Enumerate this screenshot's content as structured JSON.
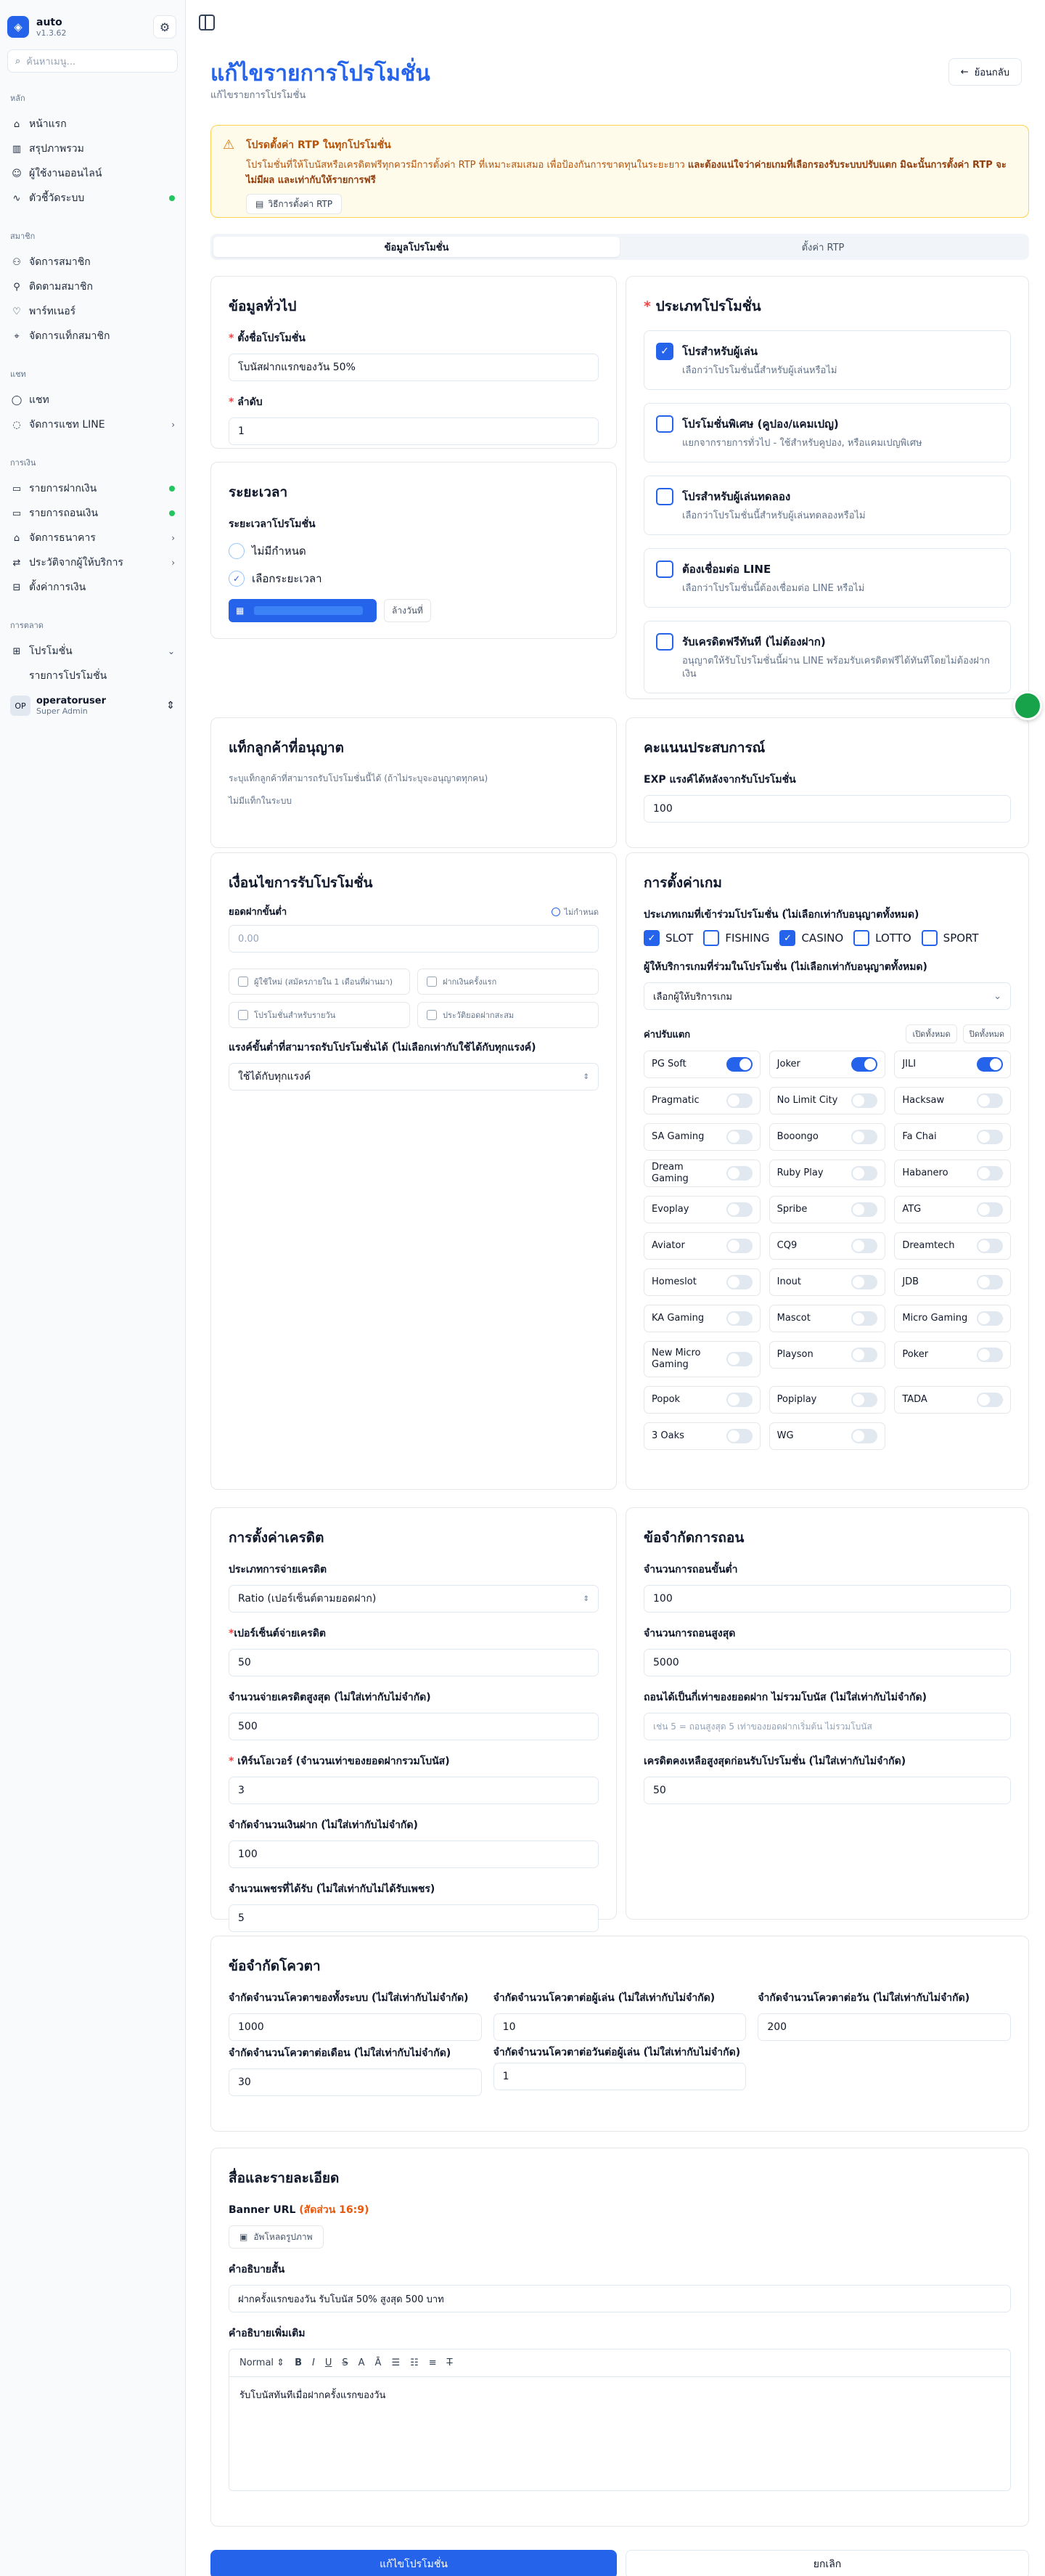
{
  "app": {
    "name": "auto",
    "version": "v1.3.62",
    "search_placeholder": "ค้นหาเมนู..."
  },
  "sidebar": {
    "sections": [
      {
        "title": "หลัก",
        "items": [
          {
            "label": "หน้าแรก",
            "icon": "home-icon"
          },
          {
            "label": "สรุปภาพรวม",
            "icon": "chart-icon"
          },
          {
            "label": "ผู้ใช้งานออนไลน์",
            "icon": "users-icon"
          },
          {
            "label": "ตัวชี้วัดระบบ",
            "icon": "activity-icon",
            "dot": true
          }
        ]
      },
      {
        "title": "สมาชิก",
        "items": [
          {
            "label": "จัดการสมาชิก",
            "icon": "user-cog-icon"
          },
          {
            "label": "ติดตามสมาชิก",
            "icon": "user-search-icon"
          },
          {
            "label": "พาร์ทเนอร์",
            "icon": "handshake-icon"
          },
          {
            "label": "จัดการแท็กสมาชิก",
            "icon": "tag-icon"
          }
        ]
      },
      {
        "title": "แชท",
        "items": [
          {
            "label": "แชท",
            "icon": "chat-icon"
          },
          {
            "label": "จัดการแชท LINE",
            "icon": "line-chat-icon",
            "chev": true
          }
        ]
      },
      {
        "title": "การเงิน",
        "items": [
          {
            "label": "รายการฝากเงิน",
            "icon": "deposit-icon",
            "dot": true
          },
          {
            "label": "รายการถอนเงิน",
            "icon": "withdraw-icon",
            "dot": true
          },
          {
            "label": "จัดการธนาคาร",
            "icon": "bank-icon",
            "chev": true
          },
          {
            "label": "ประวัติจากผู้ให้บริการ",
            "icon": "history-icon",
            "chev": true
          },
          {
            "label": "ตั้งค่าการเงิน",
            "icon": "money-settings-icon"
          }
        ]
      }
    ],
    "marketing": {
      "title": "การตลาด",
      "group": "โปรโมชั่น",
      "sub": "รายการโปรโมชั่น"
    },
    "user": {
      "initials": "OP",
      "name": "operatoruser",
      "role": "Super Admin"
    }
  },
  "page": {
    "title": "แก้ไขรายการโปรโมชั่น",
    "subtitle": "แก้ไขรายการโปรโมชั่น",
    "back": "ย้อนกลับ"
  },
  "alert": {
    "title": "โปรดตั้งค่า RTP ในทุกโปรโมชั่น",
    "body": "โปรโมชั่นที่ให้โบนัสหรือเครดิตฟรีทุกควรมีการตั้งค่า RTP ที่เหมาะสมเสมอ เพื่อป้องกันการขาดทุนในระยะยาว",
    "body_bold": "และต้องแน่ใจว่าค่ายเกมที่เลือกรองรับระบบปรับแตก มิฉะนั้นการตั้งค่า RTP จะไม่มีผล และเท่ากับให้รายการฟรี",
    "button": "วิธีการตั้งค่า RTP"
  },
  "tabs": [
    "ข้อมูลโปรโมชั่น",
    "ตั้งค่า RTP"
  ],
  "general": {
    "title": "ข้อมูลทั่วไป",
    "name_label": "ตั้งชื่อโปรโมชั่น",
    "name_value": "โบนัสฝากแรกของวัน 50%",
    "order_label": "ลำดับ",
    "order_value": "1"
  },
  "period": {
    "title": "ระยะเวลา",
    "label": "ระยะเวลาโปรโมชั่น",
    "opt1": "ไม่มีกำหนด",
    "opt2": "เลือกระยะเวลา",
    "clear": "ล้างวันที่"
  },
  "ptype": {
    "title": "ประเภทโปรโมชั่น",
    "items": [
      {
        "t": "โปรสำหรับผู้เล่น",
        "d": "เลือกว่าโปรโมชั่นนี้สำหรับผู้เล่นหรือไม่",
        "on": true
      },
      {
        "t": "โปรโมชั่นพิเศษ (คูปอง/แคมเปญ)",
        "d": "แยกจากรายการทั่วไป - ใช้สำหรับคูปอง, หรือแคมเปญพิเศษ",
        "on": false
      },
      {
        "t": "โปรสำหรับผู้เล่นทดลอง",
        "d": "เลือกว่าโปรโมชั่นนี้สำหรับผู้เล่นทดลองหรือไม่",
        "on": false
      },
      {
        "t": "ต้องเชื่อมต่อ LINE",
        "d": "เลือกว่าโปรโมชั่นนี้ต้องเชื่อมต่อ LINE หรือไม่",
        "on": false
      },
      {
        "t": "รับเครดิตฟรีทันที (ไม่ต้องฝาก)",
        "d": "อนุญาตให้รับโปรโมชั่นนี้ผ่าน LINE พร้อมรับเครดิตฟรีได้ทันทีโดยไม่ต้องฝากเงิน",
        "on": false
      }
    ]
  },
  "tags": {
    "title": "แท็กลูกค้าที่อนุญาต",
    "desc": "ระบุแท็กลูกค้าที่สามารถรับโปรโมชั่นนี้ได้ (ถ้าไม่ระบุจะอนุญาตทุกคน)",
    "empty": "ไม่มีแท็กในระบบ"
  },
  "exp": {
    "title": "คะแนนประสบการณ์",
    "label": "EXP แรงค์ได้หลังจากรับโปรโมชั่น",
    "value": "100"
  },
  "cond": {
    "title": "เงื่อนไขการรับโปรโมชั่น",
    "min_label": "ยอดฝากขั้นต่ำ",
    "no_limit": "ไม่กำหนด",
    "min_ph": "0.00",
    "checks": [
      "ผู้ใช้ใหม่ (สมัครภายใน 1 เดือนที่ผ่านมา)",
      "ฝากเงินครั้งแรก",
      "โปรโมชั่นสำหรับรายวัน",
      "ประวัติยอดฝากสะสม"
    ],
    "rank_label": "แรงค์ขั้นต่ำที่สามารถรับโปรโมชั่นได้ (ไม่เลือกเท่ากับใช้ได้กับทุกแรงค์)",
    "rank_value": "ใช้ได้กับทุกแรงค์"
  },
  "game": {
    "title": "การตั้งค่าเกม",
    "types_label": "ประเภทเกมที่เข้าร่วมโปรโมชั่น (ไม่เลือกเท่ากับอนุญาตทั้งหมด)",
    "types": [
      {
        "n": "SLOT",
        "on": true
      },
      {
        "n": "FISHING",
        "on": false
      },
      {
        "n": "CASINO",
        "on": true
      },
      {
        "n": "LOTTO",
        "on": false
      },
      {
        "n": "SPORT",
        "on": false
      }
    ],
    "prov_label": "ผู้ให้บริการเกมที่ร่วมในโปรโมชั่น (ไม่เลือกเท่ากับอนุญาตทั้งหมด)",
    "prov_ph": "เลือกผู้ให้บริการเกม",
    "adj_label": "ค่าปรับแตก",
    "open_all": "เปิดทั้งหมด",
    "close_all": "ปิดทั้งหมด",
    "providers": [
      [
        "PG Soft",
        true
      ],
      [
        "Joker",
        true
      ],
      [
        "JILI",
        true
      ],
      [
        "Pragmatic",
        false
      ],
      [
        "No Limit City",
        false
      ],
      [
        "Hacksaw",
        false
      ],
      [
        "SA Gaming",
        false
      ],
      [
        "Booongo",
        false
      ],
      [
        "Fa Chai",
        false
      ],
      [
        "Dream Gaming",
        false
      ],
      [
        "Ruby Play",
        false
      ],
      [
        "Habanero",
        false
      ],
      [
        "Evoplay",
        false
      ],
      [
        "Spribe",
        false
      ],
      [
        "ATG",
        false
      ],
      [
        "Aviator",
        false
      ],
      [
        "CQ9",
        false
      ],
      [
        "Dreamtech",
        false
      ],
      [
        "Homeslot",
        false
      ],
      [
        "Inout",
        false
      ],
      [
        "JDB",
        false
      ],
      [
        "KA Gaming",
        false
      ],
      [
        "Mascot",
        false
      ],
      [
        "Micro Gaming",
        false
      ],
      [
        "New Micro Gaming",
        false
      ],
      [
        "Playson",
        false
      ],
      [
        "Poker",
        false
      ],
      [
        "Popok",
        false
      ],
      [
        "Popiplay",
        false
      ],
      [
        "TADA",
        false
      ],
      [
        "3 Oaks",
        false
      ],
      [
        "WG",
        false
      ]
    ]
  },
  "credit": {
    "title": "การตั้งค่าเครดิต",
    "type_label": "ประเภทการจ่ายเครดิต",
    "type_value": "Ratio (เปอร์เซ็นต์ตามยอดฝาก)",
    "pct_label": "เปอร์เซ็นต์จ่ายเครดิต",
    "pct_value": "50",
    "max_label": "จำนวนจ่ายเครดิตสูงสุด (ไม่ใส่เท่ากับไม่จำกัด)",
    "max_value": "500",
    "turn_label": "เทิร์นโอเวอร์ (จำนวนเท่าของยอดฝากรวมโบนัส)",
    "turn_value": "3",
    "dep_label": "จำกัดจำนวนเงินฝาก (ไม่ใส่เท่ากับไม่จำกัด)",
    "dep_value": "100",
    "gem_label": "จำนวนเพชรที่ได้รับ (ไม่ใส่เท่ากับไม่ได้รับเพชร)",
    "gem_value": "5"
  },
  "withdraw": {
    "title": "ข้อจำกัดการถอน",
    "min_label": "จำนวนการถอนขั้นต่ำ",
    "min_value": "100",
    "max_label": "จำนวนการถอนสูงสุด",
    "max_value": "5000",
    "mult_label": "ถอนได้เป็นกี่เท่าของยอดฝาก ไม่รวมโบนัส (ไม่ใส่เท่ากับไม่จำกัด)",
    "mult_ph": "เช่น 5 = ถอนสูงสุด 5 เท่าของยอดฝากเริ่มต้น ไม่รวมโบนัส",
    "rem_label": "เครดิตคงเหลือสูงสุดก่อนรับโปรโมชั่น (ไม่ใส่เท่ากับไม่จำกัด)",
    "rem_value": "50"
  },
  "quota": {
    "title": "ข้อจำกัดโควตา",
    "sys_label": "จำกัดจำนวนโควตาของทั้งระบบ (ไม่ใส่เท่ากับไม่จำกัด)",
    "sys_value": "1000",
    "player_label": "จำกัดจำนวนโควตาต่อผู้เล่น (ไม่ใส่เท่ากับไม่จำกัด)",
    "player_value": "10",
    "day_label": "จำกัดจำนวนโควตาต่อวัน (ไม่ใส่เท่ากับไม่จำกัด)",
    "day_value": "200",
    "month_label": "จำกัดจำนวนโควตาต่อเดือน (ไม่ใส่เท่ากับไม่จำกัด)",
    "month_value": "30",
    "pday_label": "จำกัดจำนวนโควตาต่อวันต่อผู้เล่น (ไม่ใส่เท่ากับไม่จำกัด)",
    "pday_value": "1"
  },
  "media": {
    "title": "สื่อและรายละเอียด",
    "banner_label": "Banner URL",
    "banner_ratio": "(สัดส่วน 16:9)",
    "upload": "อัพโหลดรูปภาพ",
    "short_label": "คำอธิบายสั้น",
    "short_value": "ฝากครั้งแรกของวัน รับโบนัส 50% สูงสุด 500 บาท",
    "more_label": "คำอธิบายเพิ่มเติม",
    "editor_style": "Normal",
    "editor_text": "รับโบนัสทันทีเมื่อฝากครั้งแรกของวัน"
  },
  "actions": {
    "save": "แก้ไขโปรโมชั่น",
    "cancel": "ยกเลิก"
  }
}
